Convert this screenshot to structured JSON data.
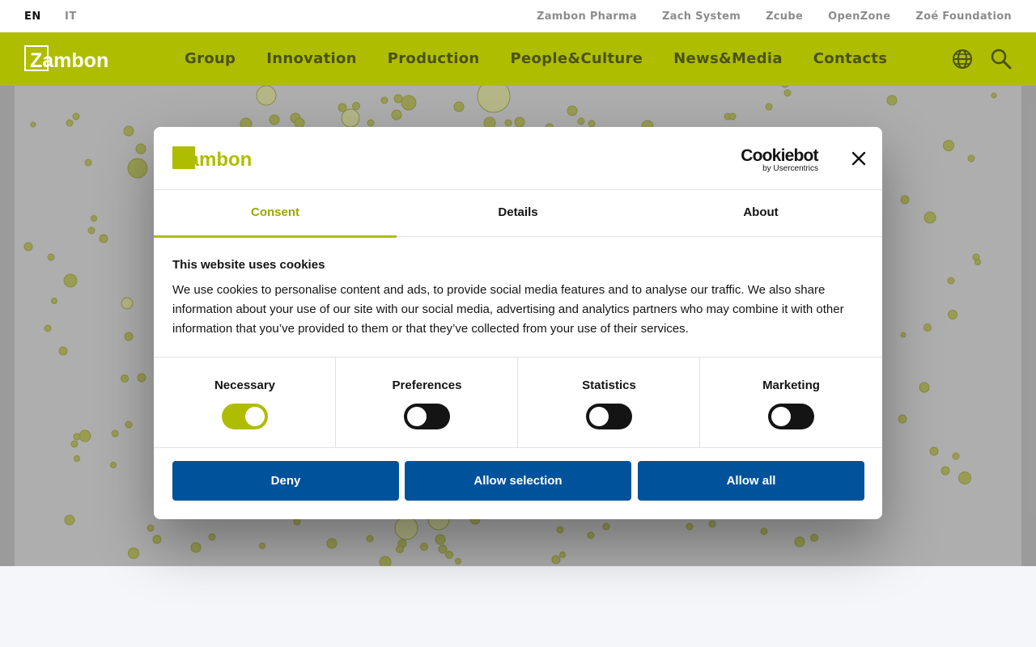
{
  "topbar": {
    "languages": [
      "EN",
      "IT"
    ],
    "sister_sites": [
      "Zambon Pharma",
      "Zach System",
      "Zcube",
      "OpenZone",
      "Zoé Foundation"
    ]
  },
  "header": {
    "logo_text": "Zambon",
    "nav": [
      "Group",
      "Innovation",
      "Production",
      "People&Culture",
      "News&Media",
      "Contacts"
    ],
    "icons": [
      "globe-icon",
      "search-icon"
    ]
  },
  "colors": {
    "brand_green": "#afbd00",
    "button_blue": "#00529b",
    "nav_text": "#4a5210"
  },
  "dialog": {
    "logo_text": "Zambon",
    "provider_brand": "Cookiebot",
    "provider_sub": "by Usercentrics",
    "tabs": [
      "Consent",
      "Details",
      "About"
    ],
    "active_tab": "Consent",
    "title": "This website uses cookies",
    "body": "We use cookies to personalise content and ads, to provide social media features and to analyse our traffic. We also share information about your use of our site with our social media, advertising and analytics partners who may combine it with other information that you’ve provided to them or that they’ve collected from your use of their services.",
    "categories": [
      {
        "label": "Necessary",
        "enabled": true
      },
      {
        "label": "Preferences",
        "enabled": false
      },
      {
        "label": "Statistics",
        "enabled": false
      },
      {
        "label": "Marketing",
        "enabled": false
      }
    ],
    "buttons": {
      "deny": "Deny",
      "allow_selection": "Allow selection",
      "allow_all": "Allow all"
    }
  }
}
